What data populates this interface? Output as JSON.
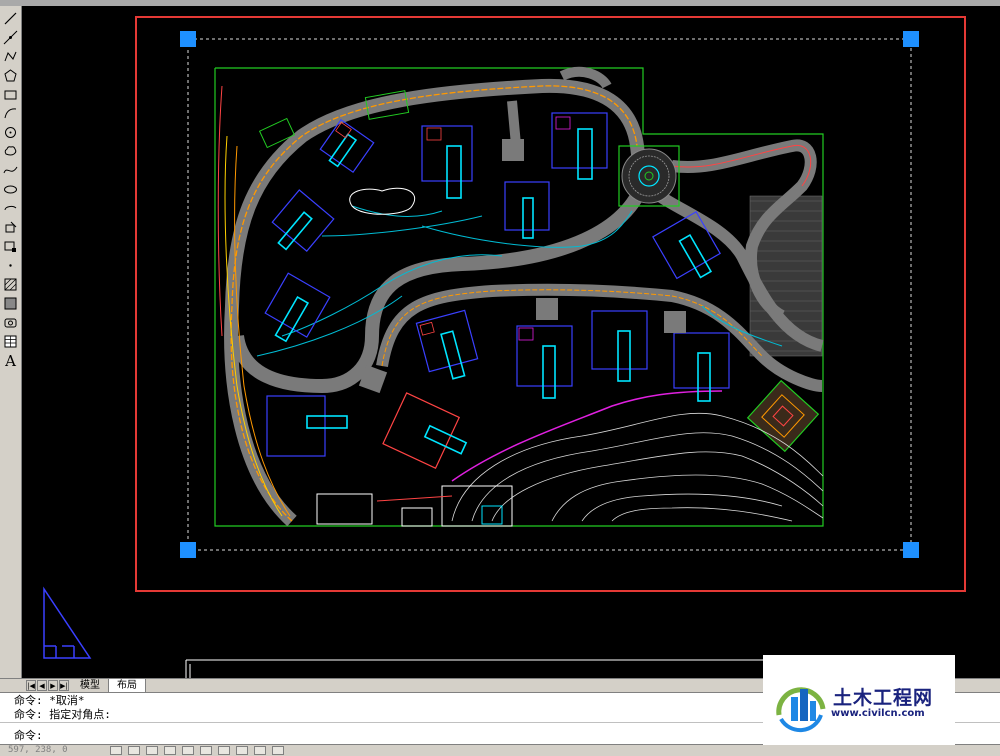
{
  "colors": {
    "background": "#000000",
    "viewport_frame": "#e53935",
    "grip": "#1e90ff",
    "site_boundary": "#22cc22",
    "road": "#7a7a7a",
    "curb": "#ff9900",
    "building_wall": "#3a40ff",
    "building_core": "#00e5ff",
    "contour": "#ffffff",
    "magenta": "#e020e0"
  },
  "toolbar": {
    "tools": [
      {
        "icon": "line-icon"
      },
      {
        "icon": "construction-line-icon"
      },
      {
        "icon": "polyline-icon"
      },
      {
        "icon": "polygon-icon"
      },
      {
        "icon": "rectangle-icon"
      },
      {
        "icon": "arc-icon"
      },
      {
        "icon": "circle-icon"
      },
      {
        "icon": "revision-cloud-icon"
      },
      {
        "icon": "spline-icon"
      },
      {
        "icon": "ellipse-icon"
      },
      {
        "icon": "ellipse-arc-icon"
      },
      {
        "icon": "insert-block-icon"
      },
      {
        "icon": "make-block-icon"
      },
      {
        "icon": "point-icon"
      },
      {
        "icon": "hatch-icon"
      },
      {
        "icon": "gradient-icon"
      },
      {
        "icon": "region-icon"
      },
      {
        "icon": "table-icon"
      },
      {
        "icon": "multiline-text-icon",
        "label": "A"
      }
    ]
  },
  "tabs": {
    "nav_buttons": [
      "|◀",
      "◀",
      "▶",
      "▶|"
    ],
    "model": "模型",
    "layout": "布局"
  },
  "command": {
    "history": [
      "命令: *取消*",
      "命令: 指定对角点:"
    ],
    "prompt": "命令:"
  },
  "status": {
    "coordinates": "597, 238, 0"
  },
  "watermark": {
    "title": "土木工程网",
    "url": "www.civilcn.com"
  }
}
